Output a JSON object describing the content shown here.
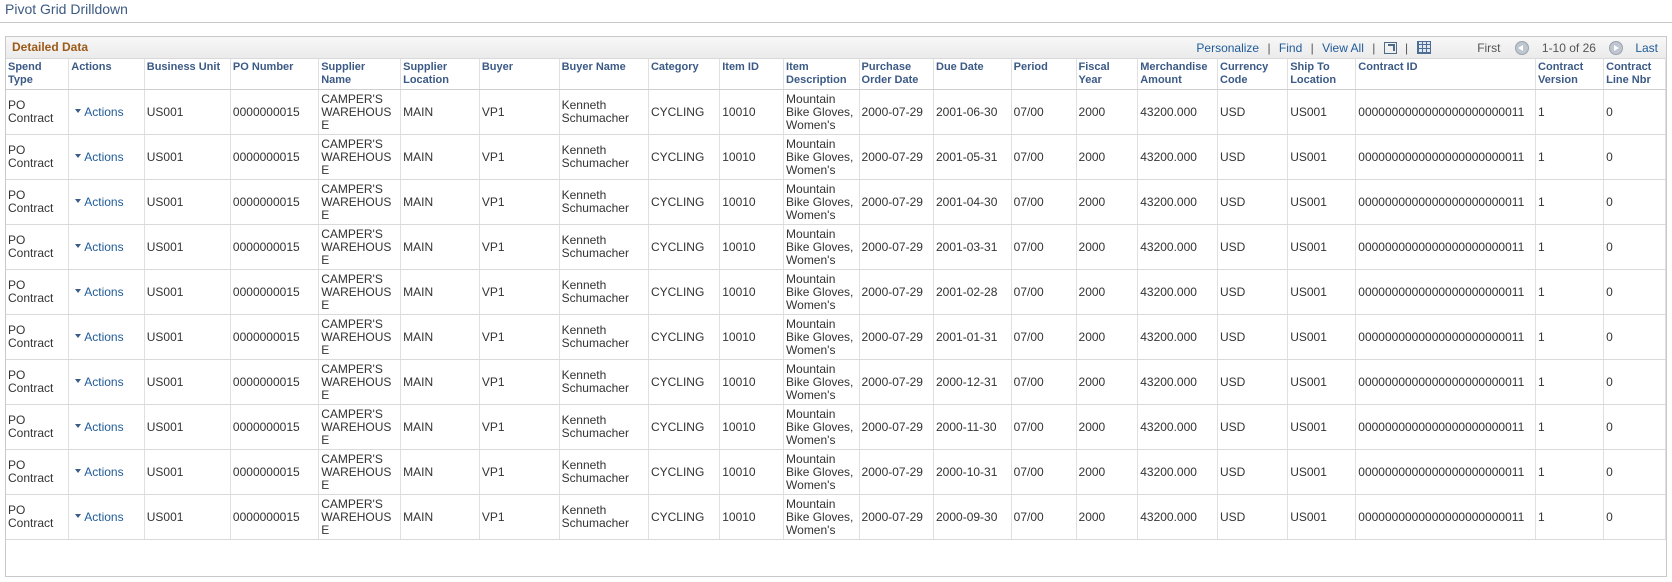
{
  "page": {
    "title": "Pivot Grid Drilldown"
  },
  "grid": {
    "title": "Detailed Data",
    "nav": {
      "personalize": "Personalize",
      "find": "Find",
      "view_all": "View All",
      "sep": "|",
      "first": "First",
      "range": "1-10 of 26",
      "last": "Last"
    },
    "columns": [
      "Spend Type",
      "Actions",
      "Business Unit",
      "PO Number",
      "Supplier Name",
      "Supplier Location",
      "Buyer",
      "Buyer Name",
      "Category",
      "Item ID",
      "Item Description",
      "Purchase Order Date",
      "Due Date",
      "Period",
      "Fiscal Year",
      "Merchandise Amount",
      "Currency Code",
      "Ship To Location",
      "Contract ID",
      "Contract Version",
      "Contract Line Nbr"
    ],
    "rows": [
      [
        "PO Contract",
        "Actions",
        "US001",
        "0000000015",
        "CAMPER'S WAREHOUSE",
        "MAIN",
        "VP1",
        "Kenneth Schumacher",
        "CYCLING",
        "10010",
        "Mountain Bike Gloves, Women's",
        "2000-07-29",
        "2001-06-30",
        "07/00",
        "2000",
        "43200.000",
        "USD",
        "US001",
        "0000000000000000000000011",
        "1",
        "0"
      ],
      [
        "PO Contract",
        "Actions",
        "US001",
        "0000000015",
        "CAMPER'S WAREHOUSE",
        "MAIN",
        "VP1",
        "Kenneth Schumacher",
        "CYCLING",
        "10010",
        "Mountain Bike Gloves, Women's",
        "2000-07-29",
        "2001-05-31",
        "07/00",
        "2000",
        "43200.000",
        "USD",
        "US001",
        "0000000000000000000000011",
        "1",
        "0"
      ],
      [
        "PO Contract",
        "Actions",
        "US001",
        "0000000015",
        "CAMPER'S WAREHOUSE",
        "MAIN",
        "VP1",
        "Kenneth Schumacher",
        "CYCLING",
        "10010",
        "Mountain Bike Gloves, Women's",
        "2000-07-29",
        "2001-04-30",
        "07/00",
        "2000",
        "43200.000",
        "USD",
        "US001",
        "0000000000000000000000011",
        "1",
        "0"
      ],
      [
        "PO Contract",
        "Actions",
        "US001",
        "0000000015",
        "CAMPER'S WAREHOUSE",
        "MAIN",
        "VP1",
        "Kenneth Schumacher",
        "CYCLING",
        "10010",
        "Mountain Bike Gloves, Women's",
        "2000-07-29",
        "2001-03-31",
        "07/00",
        "2000",
        "43200.000",
        "USD",
        "US001",
        "0000000000000000000000011",
        "1",
        "0"
      ],
      [
        "PO Contract",
        "Actions",
        "US001",
        "0000000015",
        "CAMPER'S WAREHOUSE",
        "MAIN",
        "VP1",
        "Kenneth Schumacher",
        "CYCLING",
        "10010",
        "Mountain Bike Gloves, Women's",
        "2000-07-29",
        "2001-02-28",
        "07/00",
        "2000",
        "43200.000",
        "USD",
        "US001",
        "0000000000000000000000011",
        "1",
        "0"
      ],
      [
        "PO Contract",
        "Actions",
        "US001",
        "0000000015",
        "CAMPER'S WAREHOUSE",
        "MAIN",
        "VP1",
        "Kenneth Schumacher",
        "CYCLING",
        "10010",
        "Mountain Bike Gloves, Women's",
        "2000-07-29",
        "2001-01-31",
        "07/00",
        "2000",
        "43200.000",
        "USD",
        "US001",
        "0000000000000000000000011",
        "1",
        "0"
      ],
      [
        "PO Contract",
        "Actions",
        "US001",
        "0000000015",
        "CAMPER'S WAREHOUSE",
        "MAIN",
        "VP1",
        "Kenneth Schumacher",
        "CYCLING",
        "10010",
        "Mountain Bike Gloves, Women's",
        "2000-07-29",
        "2000-12-31",
        "07/00",
        "2000",
        "43200.000",
        "USD",
        "US001",
        "0000000000000000000000011",
        "1",
        "0"
      ],
      [
        "PO Contract",
        "Actions",
        "US001",
        "0000000015",
        "CAMPER'S WAREHOUSE",
        "MAIN",
        "VP1",
        "Kenneth Schumacher",
        "CYCLING",
        "10010",
        "Mountain Bike Gloves, Women's",
        "2000-07-29",
        "2000-11-30",
        "07/00",
        "2000",
        "43200.000",
        "USD",
        "US001",
        "0000000000000000000000011",
        "1",
        "0"
      ],
      [
        "PO Contract",
        "Actions",
        "US001",
        "0000000015",
        "CAMPER'S WAREHOUSE",
        "MAIN",
        "VP1",
        "Kenneth Schumacher",
        "CYCLING",
        "10010",
        "Mountain Bike Gloves, Women's",
        "2000-07-29",
        "2000-10-31",
        "07/00",
        "2000",
        "43200.000",
        "USD",
        "US001",
        "0000000000000000000000011",
        "1",
        "0"
      ],
      [
        "PO Contract",
        "Actions",
        "US001",
        "0000000015",
        "CAMPER'S WAREHOUSE",
        "MAIN",
        "VP1",
        "Kenneth Schumacher",
        "CYCLING",
        "10010",
        "Mountain Bike Gloves, Women's",
        "2000-07-29",
        "2000-09-30",
        "07/00",
        "2000",
        "43200.000",
        "USD",
        "US001",
        "0000000000000000000000011",
        "1",
        "0"
      ]
    ]
  },
  "icons": {
    "zoom": "zoom-icon",
    "download": "grid-download-icon",
    "prev": "previous-arrow-icon",
    "next": "next-arrow-icon",
    "action_menu": "caret-down-icon"
  }
}
